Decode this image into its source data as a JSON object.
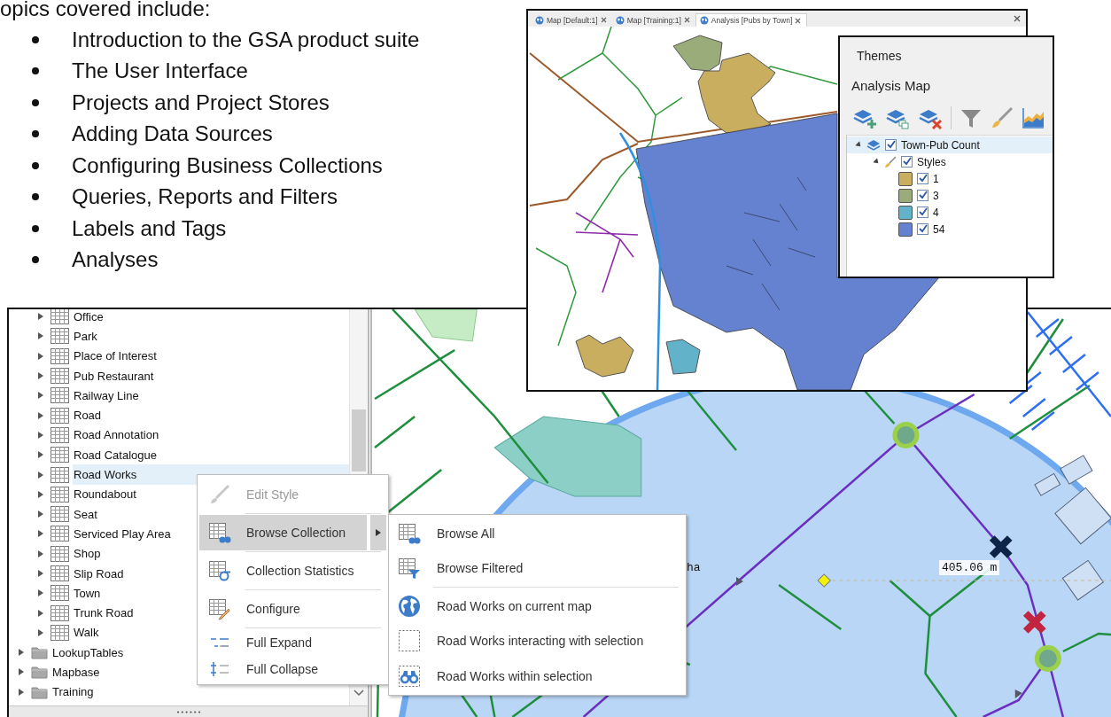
{
  "intro": {
    "heading": "opics covered include:",
    "bullets": [
      "Introduction to the GSA product suite",
      "The User Interface",
      "Projects and Project Stores",
      "Adding Data Sources",
      "Configuring Business Collections",
      "Queries, Reports and Filters",
      "Labels and Tags",
      "Analyses"
    ]
  },
  "collection_tree": {
    "items": [
      {
        "label": "Office",
        "kind": "table",
        "expanded": false,
        "selected": false
      },
      {
        "label": "Park",
        "kind": "table",
        "expanded": false,
        "selected": false
      },
      {
        "label": "Place of Interest",
        "kind": "table",
        "expanded": false,
        "selected": false
      },
      {
        "label": "Pub Restaurant",
        "kind": "table",
        "expanded": false,
        "selected": false
      },
      {
        "label": "Railway Line",
        "kind": "table",
        "expanded": false,
        "selected": false
      },
      {
        "label": "Road",
        "kind": "table",
        "expanded": false,
        "selected": false
      },
      {
        "label": "Road Annotation",
        "kind": "table",
        "expanded": false,
        "selected": false
      },
      {
        "label": "Road Catalogue",
        "kind": "table",
        "expanded": false,
        "selected": false
      },
      {
        "label": "Road Works",
        "kind": "table",
        "expanded": false,
        "selected": true
      },
      {
        "label": "Roundabout",
        "kind": "table",
        "expanded": false,
        "selected": false
      },
      {
        "label": "Seat",
        "kind": "table",
        "expanded": false,
        "selected": false
      },
      {
        "label": "Serviced Play Area",
        "kind": "table",
        "expanded": false,
        "selected": false
      },
      {
        "label": "Shop",
        "kind": "table",
        "expanded": false,
        "selected": false
      },
      {
        "label": "Slip Road",
        "kind": "table",
        "expanded": false,
        "selected": false
      },
      {
        "label": "Town",
        "kind": "table",
        "expanded": false,
        "selected": false
      },
      {
        "label": "Trunk Road",
        "kind": "table",
        "expanded": false,
        "selected": false
      },
      {
        "label": "Walk",
        "kind": "table",
        "expanded": false,
        "selected": false
      },
      {
        "label": "LookupTables",
        "kind": "folder",
        "expanded": false,
        "selected": false
      },
      {
        "label": "Mapbase",
        "kind": "folder",
        "expanded": false,
        "selected": false
      },
      {
        "label": "Training",
        "kind": "folder",
        "expanded": false,
        "selected": false
      }
    ]
  },
  "context_menu": {
    "items": [
      {
        "label": "Edit Style",
        "kind": "brush",
        "disabled": true,
        "selected": false,
        "has_submenu": false,
        "separator_after": true
      },
      {
        "label": "Browse Collection",
        "kind": "browse",
        "disabled": false,
        "selected": true,
        "has_submenu": true,
        "separator_after": true
      },
      {
        "label": "Collection Statistics",
        "kind": "statistics",
        "disabled": false,
        "selected": false,
        "has_submenu": false,
        "separator_after": true
      },
      {
        "label": "Configure",
        "kind": "configure",
        "disabled": false,
        "selected": false,
        "has_submenu": false,
        "separator_after": true
      },
      {
        "label": "Full Expand",
        "kind": "expand",
        "disabled": false,
        "selected": false,
        "has_submenu": false,
        "separator_after": false
      },
      {
        "label": "Full Collapse",
        "kind": "collapse",
        "disabled": false,
        "selected": false,
        "has_submenu": false,
        "separator_after": false
      }
    ]
  },
  "submenu": {
    "items": [
      {
        "label": "Browse All",
        "kind": "browse",
        "separator_after": false
      },
      {
        "label": "Browse Filtered",
        "kind": "filter",
        "separator_after": true
      },
      {
        "label": "Road Works on current map",
        "kind": "globe",
        "separator_after": false
      },
      {
        "label": "Road Works interacting with selection",
        "kind": "dashed",
        "separator_after": false
      },
      {
        "label": "Road Works within selection",
        "kind": "binoculars",
        "separator_after": false
      }
    ]
  },
  "map": {
    "partial_label": "ha",
    "measurement": "405.06 m"
  },
  "analysis_window": {
    "tabs": [
      {
        "label": "Map [Default:1]",
        "selected": false
      },
      {
        "label": "Map [Training:1]",
        "selected": false
      },
      {
        "label": "Analysis [Pubs by Town]",
        "selected": true
      }
    ],
    "themes": {
      "title": "Themes",
      "subtitle": "Analysis Map",
      "layers": [
        {
          "label": "Town-Pub Count",
          "checked": true,
          "expanded": true,
          "selected": true,
          "children": [
            {
              "label": "Styles",
              "checked": true,
              "expanded": true,
              "children": [
                {
                  "label": "1",
                  "color": "#c9ae60",
                  "checked": true
                },
                {
                  "label": "3",
                  "color": "#99ac7a",
                  "checked": true
                },
                {
                  "label": "4",
                  "color": "#62b2c9",
                  "checked": true
                },
                {
                  "label": "54",
                  "color": "#6482d0",
                  "checked": true
                }
              ]
            }
          ]
        }
      ]
    }
  }
}
